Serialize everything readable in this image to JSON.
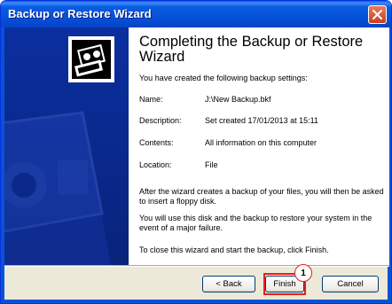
{
  "window": {
    "title": "Backup or Restore Wizard",
    "close_icon": "close-icon"
  },
  "sidebar": {
    "icon": "backup-tape-icon"
  },
  "main": {
    "heading": "Completing the Backup or Restore Wizard",
    "intro": "You have created the following backup settings:",
    "settings": [
      {
        "label": "Name:",
        "value": "J:\\New Backup.bkf"
      },
      {
        "label": "Description:",
        "value": "Set created 17/01/2013 at 15:11"
      },
      {
        "label": "Contents:",
        "value": "All information on this computer"
      },
      {
        "label": "Location:",
        "value": "File"
      }
    ],
    "para1": "After the wizard creates a backup of your files, you will then be asked to insert a floppy disk.",
    "para2": "You will use this disk and the backup to restore your system in the event of a major failure.",
    "para3": "To close this wizard and start the backup, click Finish."
  },
  "buttons": {
    "back": "< Back",
    "finish": "Finish",
    "cancel": "Cancel"
  },
  "annotation": {
    "callout_number": "1",
    "color": "#e52020"
  },
  "colors": {
    "titlebar": "#0553d8",
    "sidebar": "#0b2b8e"
  }
}
